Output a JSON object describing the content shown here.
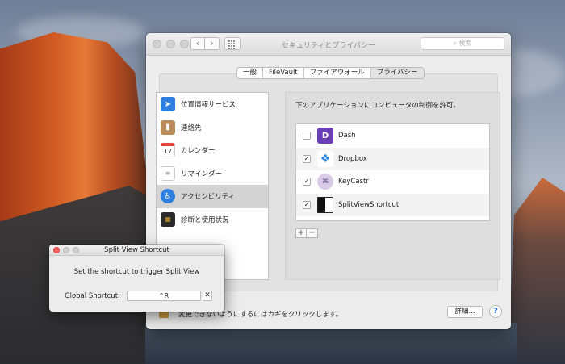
{
  "window": {
    "title": "セキュリティとプライバシー",
    "search_placeholder": "検索",
    "nav_back": "‹",
    "nav_forward": "›"
  },
  "tabs": [
    {
      "label": "一般"
    },
    {
      "label": "FileVault"
    },
    {
      "label": "ファイアウォール"
    },
    {
      "label": "プライバシー"
    }
  ],
  "active_tab": "プライバシー",
  "sidebar": {
    "items": [
      {
        "label": "位置情報サービス",
        "icon": "location-arrow-icon"
      },
      {
        "label": "連絡先",
        "icon": "contacts-book-icon"
      },
      {
        "label": "カレンダー",
        "icon": "calendar-icon",
        "icon_text": "17"
      },
      {
        "label": "リマインダー",
        "icon": "reminders-list-icon"
      },
      {
        "label": "アクセシビリティ",
        "icon": "accessibility-icon"
      },
      {
        "label": "診断と使用状況",
        "icon": "diagnostics-grid-icon"
      }
    ],
    "selected": "アクセシビリティ"
  },
  "main": {
    "header": "下のアプリケーションにコンピュータの制御を許可。",
    "apps": [
      {
        "name": "Dash",
        "checked": false,
        "icon": "dash-app-icon",
        "icon_text": "D"
      },
      {
        "name": "Dropbox",
        "checked": true,
        "icon": "dropbox-app-icon"
      },
      {
        "name": "KeyCastr",
        "checked": true,
        "icon": "keycastr-app-icon"
      },
      {
        "name": "SplitViewShortcut",
        "checked": true,
        "icon": "splitview-app-icon"
      }
    ],
    "add_label": "+",
    "remove_label": "−"
  },
  "footer": {
    "lock_text": "変更できないようにするにはカギをクリックします。",
    "details_button": "詳細...",
    "help_button": "?"
  },
  "split_view": {
    "title": "Split View Shortcut",
    "message": "Set the shortcut to trigger Split View",
    "shortcut_label": "Global Shortcut:",
    "shortcut_value": "^R",
    "clear_button": "✕"
  },
  "colors": {
    "accent_blue": "#2b6fd6",
    "close_red": "#fc5f57",
    "selection_gray": "#d3d3d3"
  }
}
